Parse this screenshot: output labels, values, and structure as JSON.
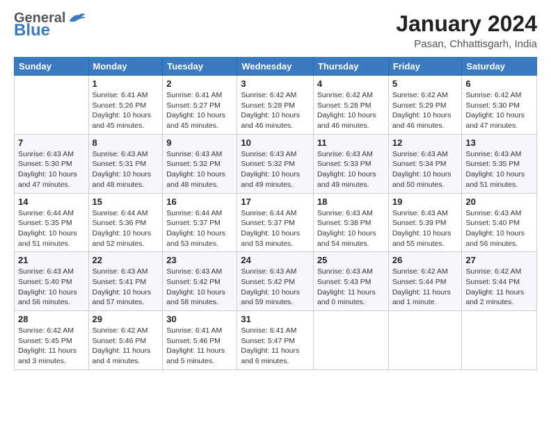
{
  "header": {
    "logo_general": "General",
    "logo_blue": "Blue",
    "month_year": "January 2024",
    "location": "Pasan, Chhattisgarh, India"
  },
  "weekdays": [
    "Sunday",
    "Monday",
    "Tuesday",
    "Wednesday",
    "Thursday",
    "Friday",
    "Saturday"
  ],
  "weeks": [
    [
      {
        "day": "",
        "info": ""
      },
      {
        "day": "1",
        "info": "Sunrise: 6:41 AM\nSunset: 5:26 PM\nDaylight: 10 hours\nand 45 minutes."
      },
      {
        "day": "2",
        "info": "Sunrise: 6:41 AM\nSunset: 5:27 PM\nDaylight: 10 hours\nand 45 minutes."
      },
      {
        "day": "3",
        "info": "Sunrise: 6:42 AM\nSunset: 5:28 PM\nDaylight: 10 hours\nand 46 minutes."
      },
      {
        "day": "4",
        "info": "Sunrise: 6:42 AM\nSunset: 5:28 PM\nDaylight: 10 hours\nand 46 minutes."
      },
      {
        "day": "5",
        "info": "Sunrise: 6:42 AM\nSunset: 5:29 PM\nDaylight: 10 hours\nand 46 minutes."
      },
      {
        "day": "6",
        "info": "Sunrise: 6:42 AM\nSunset: 5:30 PM\nDaylight: 10 hours\nand 47 minutes."
      }
    ],
    [
      {
        "day": "7",
        "info": "Sunrise: 6:43 AM\nSunset: 5:30 PM\nDaylight: 10 hours\nand 47 minutes."
      },
      {
        "day": "8",
        "info": "Sunrise: 6:43 AM\nSunset: 5:31 PM\nDaylight: 10 hours\nand 48 minutes."
      },
      {
        "day": "9",
        "info": "Sunrise: 6:43 AM\nSunset: 5:32 PM\nDaylight: 10 hours\nand 48 minutes."
      },
      {
        "day": "10",
        "info": "Sunrise: 6:43 AM\nSunset: 5:32 PM\nDaylight: 10 hours\nand 49 minutes."
      },
      {
        "day": "11",
        "info": "Sunrise: 6:43 AM\nSunset: 5:33 PM\nDaylight: 10 hours\nand 49 minutes."
      },
      {
        "day": "12",
        "info": "Sunrise: 6:43 AM\nSunset: 5:34 PM\nDaylight: 10 hours\nand 50 minutes."
      },
      {
        "day": "13",
        "info": "Sunrise: 6:43 AM\nSunset: 5:35 PM\nDaylight: 10 hours\nand 51 minutes."
      }
    ],
    [
      {
        "day": "14",
        "info": "Sunrise: 6:44 AM\nSunset: 5:35 PM\nDaylight: 10 hours\nand 51 minutes."
      },
      {
        "day": "15",
        "info": "Sunrise: 6:44 AM\nSunset: 5:36 PM\nDaylight: 10 hours\nand 52 minutes."
      },
      {
        "day": "16",
        "info": "Sunrise: 6:44 AM\nSunset: 5:37 PM\nDaylight: 10 hours\nand 53 minutes."
      },
      {
        "day": "17",
        "info": "Sunrise: 6:44 AM\nSunset: 5:37 PM\nDaylight: 10 hours\nand 53 minutes."
      },
      {
        "day": "18",
        "info": "Sunrise: 6:43 AM\nSunset: 5:38 PM\nDaylight: 10 hours\nand 54 minutes."
      },
      {
        "day": "19",
        "info": "Sunrise: 6:43 AM\nSunset: 5:39 PM\nDaylight: 10 hours\nand 55 minutes."
      },
      {
        "day": "20",
        "info": "Sunrise: 6:43 AM\nSunset: 5:40 PM\nDaylight: 10 hours\nand 56 minutes."
      }
    ],
    [
      {
        "day": "21",
        "info": "Sunrise: 6:43 AM\nSunset: 5:40 PM\nDaylight: 10 hours\nand 56 minutes."
      },
      {
        "day": "22",
        "info": "Sunrise: 6:43 AM\nSunset: 5:41 PM\nDaylight: 10 hours\nand 57 minutes."
      },
      {
        "day": "23",
        "info": "Sunrise: 6:43 AM\nSunset: 5:42 PM\nDaylight: 10 hours\nand 58 minutes."
      },
      {
        "day": "24",
        "info": "Sunrise: 6:43 AM\nSunset: 5:42 PM\nDaylight: 10 hours\nand 59 minutes."
      },
      {
        "day": "25",
        "info": "Sunrise: 6:43 AM\nSunset: 5:43 PM\nDaylight: 11 hours\nand 0 minutes."
      },
      {
        "day": "26",
        "info": "Sunrise: 6:42 AM\nSunset: 5:44 PM\nDaylight: 11 hours\nand 1 minute."
      },
      {
        "day": "27",
        "info": "Sunrise: 6:42 AM\nSunset: 5:44 PM\nDaylight: 11 hours\nand 2 minutes."
      }
    ],
    [
      {
        "day": "28",
        "info": "Sunrise: 6:42 AM\nSunset: 5:45 PM\nDaylight: 11 hours\nand 3 minutes."
      },
      {
        "day": "29",
        "info": "Sunrise: 6:42 AM\nSunset: 5:46 PM\nDaylight: 11 hours\nand 4 minutes."
      },
      {
        "day": "30",
        "info": "Sunrise: 6:41 AM\nSunset: 5:46 PM\nDaylight: 11 hours\nand 5 minutes."
      },
      {
        "day": "31",
        "info": "Sunrise: 6:41 AM\nSunset: 5:47 PM\nDaylight: 11 hours\nand 6 minutes."
      },
      {
        "day": "",
        "info": ""
      },
      {
        "day": "",
        "info": ""
      },
      {
        "day": "",
        "info": ""
      }
    ]
  ]
}
